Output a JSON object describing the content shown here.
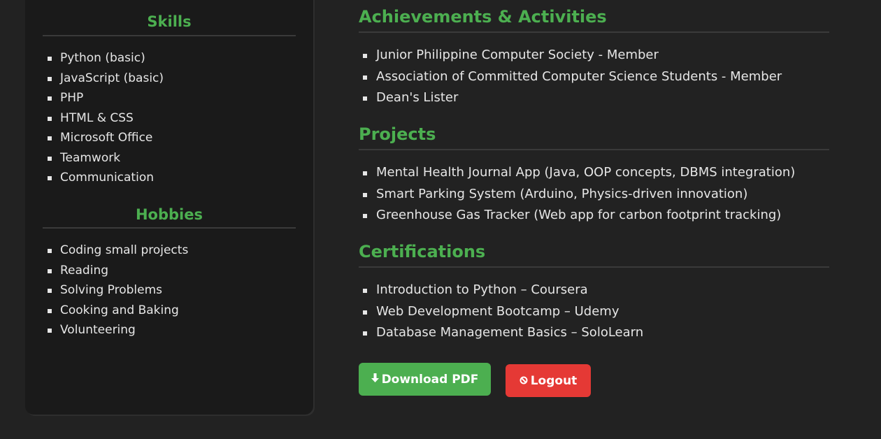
{
  "sidebar": {
    "skills": {
      "title": "Skills",
      "items": [
        "Python (basic)",
        "JavaScript (basic)",
        "PHP",
        "HTML & CSS",
        "Microsoft Office",
        "Teamwork",
        "Communication"
      ]
    },
    "hobbies": {
      "title": "Hobbies",
      "items": [
        "Coding small projects",
        "Reading",
        "Solving Problems",
        "Cooking and Baking",
        "Volunteering"
      ]
    }
  },
  "main": {
    "achievements": {
      "title": "Achievements & Activities",
      "items": [
        "Junior Philippine Computer Society - Member",
        "Association of Committed Computer Science Students - Member",
        "Dean's Lister"
      ]
    },
    "projects": {
      "title": "Projects",
      "items": [
        "Mental Health Journal App (Java, OOP concepts, DBMS integration)",
        "Smart Parking System (Arduino, Physics-driven innovation)",
        "Greenhouse Gas Tracker (Web app for carbon footprint tracking)"
      ]
    },
    "certifications": {
      "title": "Certifications",
      "items": [
        "Introduction to Python – Coursera",
        "Web Development Bootcamp – Udemy",
        "Database Management Basics – SoloLearn"
      ]
    }
  },
  "actions": {
    "download_icon": "download-arrow-icon",
    "download_label": "Download PDF",
    "logout_icon": "no-entry-icon",
    "logout_label": "Logout"
  },
  "colors": {
    "accent": "#4caf50",
    "danger": "#e53935",
    "background": "#222222",
    "panel": "#1a1a1a"
  }
}
